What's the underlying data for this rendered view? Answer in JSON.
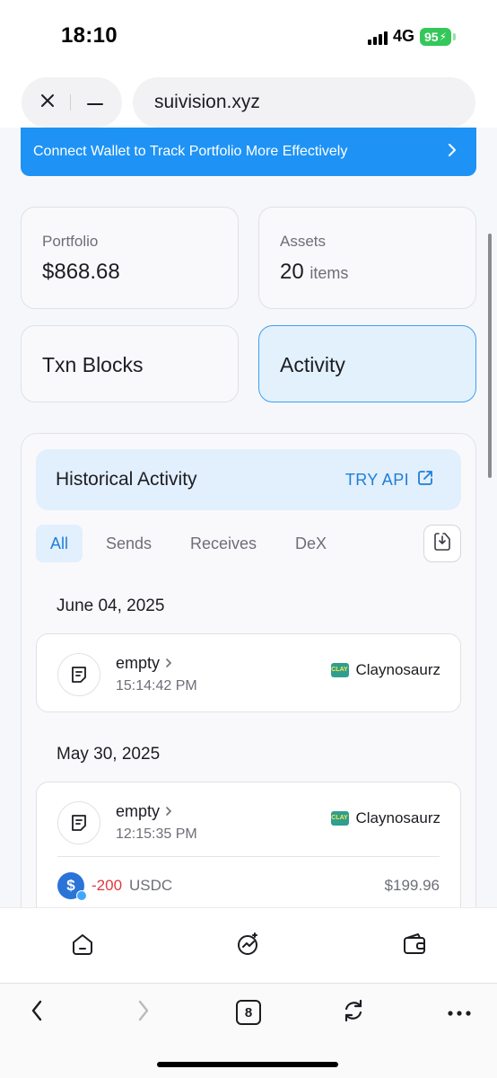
{
  "status": {
    "time": "18:10",
    "network": "4G",
    "battery": "95"
  },
  "browser": {
    "url": "suivision.xyz",
    "tab_count": "8"
  },
  "banner": {
    "text": "Connect Wallet to Track Portfolio More Effectively"
  },
  "portfolio": {
    "label": "Portfolio",
    "value": "$868.68"
  },
  "assets": {
    "label": "Assets",
    "count": "20",
    "unit": "items"
  },
  "nav_cards": {
    "txn_blocks": "Txn Blocks",
    "activity": "Activity"
  },
  "history": {
    "title": "Historical Activity",
    "try_api": "TRY API",
    "tabs": [
      "All",
      "Sends",
      "Receives",
      "DeX"
    ],
    "groups": [
      {
        "date": "June 04, 2025",
        "txns": [
          {
            "title": "empty",
            "time": "15:14:42 PM",
            "project": "Claynosaurz"
          }
        ]
      },
      {
        "date": "May 30, 2025",
        "txns": [
          {
            "title": "empty",
            "time": "12:15:35 PM",
            "project": "Claynosaurz",
            "amount": "-200",
            "token": "USDC",
            "usd": "$199.96"
          }
        ]
      }
    ]
  },
  "colors": {
    "accent": "#1e93f5",
    "negative": "#e0393e",
    "battery": "#34c759"
  }
}
